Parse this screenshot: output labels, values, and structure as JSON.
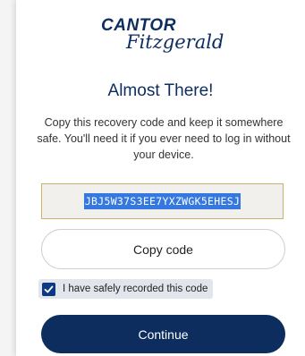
{
  "brand": {
    "name_top": "CANTOR",
    "name_bottom": "Fitzgerald",
    "reg_mark": "®",
    "color": "#0c2d5e"
  },
  "title": "Almost There!",
  "description": "Copy this recovery code and keep it somewhere safe. You'll need it if you ever need to log in without your device.",
  "recovery_code": "JBJ5W37S3EE7YXZWGK5EHESJ",
  "copy_button_label": "Copy code",
  "confirm_checkbox": {
    "label": "I have safely recorded this code",
    "checked": true
  },
  "continue_button_label": "Continue",
  "colors": {
    "primary": "#0c2d5e",
    "checkbox": "#0c3a82",
    "code_highlight": "#3478e0",
    "code_border": "#c9b36a"
  }
}
